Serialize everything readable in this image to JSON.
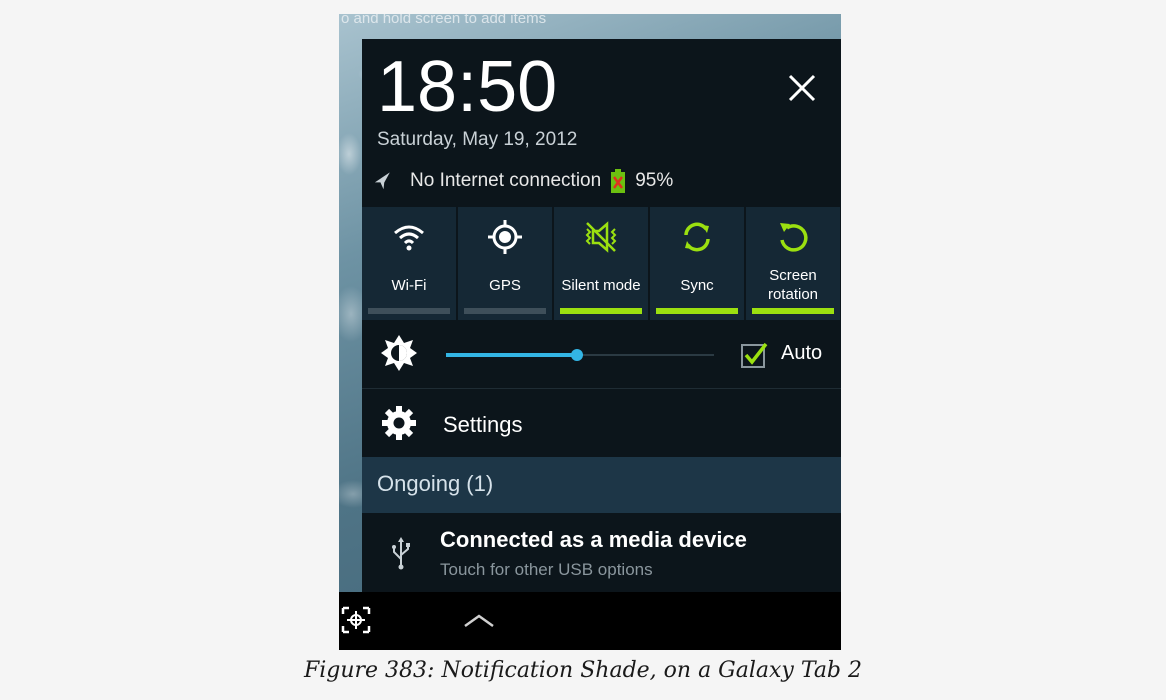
{
  "wallpaper": {
    "text": "o and hold screen to add items"
  },
  "shade": {
    "time": "18:50",
    "date": "Saturday, May 19, 2012",
    "status": {
      "connection": "No Internet connection",
      "battery": "95%",
      "icons": [
        "airplane-icon",
        "battery-icon"
      ]
    },
    "toggles": [
      {
        "label": "Wi-Fi",
        "on": false,
        "icon": "wifi-icon"
      },
      {
        "label": "GPS",
        "on": false,
        "icon": "gps-icon"
      },
      {
        "label": "Silent mode",
        "on": true,
        "icon": "silent-mode-icon"
      },
      {
        "label": "Sync",
        "on": true,
        "icon": "sync-icon"
      },
      {
        "label": "Screen rotation",
        "on": true,
        "icon": "screen-rotation-icon"
      }
    ],
    "brightness": {
      "level": 0.5,
      "auto_label": "Auto",
      "auto_checked": true
    },
    "settings_label": "Settings",
    "ongoing_label": "Ongoing (1)",
    "notification": {
      "title": "Connected as a media device",
      "subtitle": "Touch for other USB options",
      "icon": "usb-icon"
    }
  },
  "navbar": {
    "icons": [
      "screenshot-icon",
      "chevron-up-icon"
    ]
  },
  "caption": "Figure 383: Notification Shade, on a Galaxy Tab 2",
  "colors": {
    "accent": "#9be010",
    "slider": "#33b5e5",
    "tile": "#152835",
    "panel": "#0c151b"
  }
}
